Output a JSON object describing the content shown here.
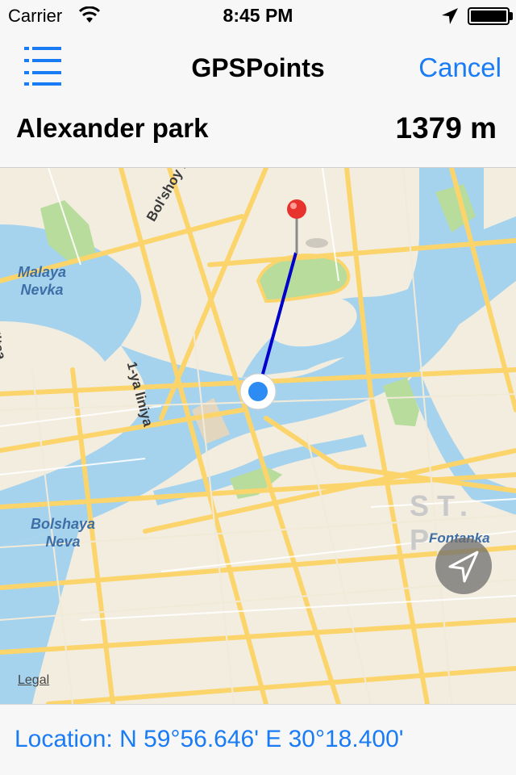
{
  "status_bar": {
    "carrier": "Carrier",
    "time": "8:45 PM",
    "wifi_icon": "wifi-icon",
    "location_icon": "location-arrow-icon",
    "battery_icon": "battery-icon"
  },
  "nav_bar": {
    "menu_icon": "list-icon",
    "title": "GPSPoints",
    "cancel_label": "Cancel"
  },
  "info": {
    "place_name": "Alexander park",
    "distance": "1379 m"
  },
  "map": {
    "labels": {
      "malaya_nevka": "Malaya\nNevka",
      "bolshaya_neva": "Bolshaya\nNeva",
      "fontanka": "Fontanka",
      "bolshoy_ps": "Bol'shoy PS prospekt",
      "ulitsa": "a ulitsa",
      "liniya": "1-ya liniya",
      "city": "ST. P"
    },
    "legal": "Legal",
    "pin_icon": "red-pin-icon",
    "user_location_icon": "user-location-icon",
    "tracking_icon": "tracking-arrow-icon"
  },
  "location": {
    "text": "Location: N 59°56.646' E 30°18.400'"
  },
  "colors": {
    "accent": "#1a7cf5",
    "water": "#a5d3ee",
    "park": "#b8dc9c",
    "road": "#fbd56b",
    "route": "#0000cc"
  }
}
